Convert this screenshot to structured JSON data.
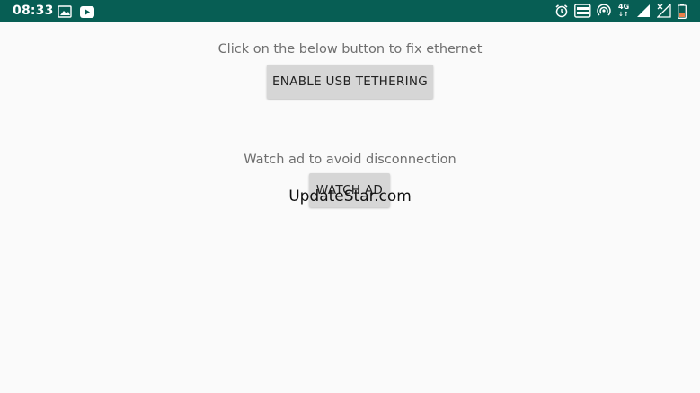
{
  "status_bar": {
    "time": "08:33",
    "network_label": "4G",
    "icons": [
      "gallery-icon",
      "youtube-icon",
      "alarm-icon",
      "volte-icon",
      "hotspot-icon",
      "signal-icon",
      "no-signal-icon",
      "battery-icon"
    ],
    "background_color": "#075e54"
  },
  "main": {
    "instruction_text": "Click  on the below button to fix ethernet",
    "enable_button_label": "ENABLE USB TETHERING",
    "ad_text": "Watch ad to avoid disconnection",
    "watch_ad_button_label": "WATCH AD"
  },
  "watermark": "UpdateStar.com"
}
